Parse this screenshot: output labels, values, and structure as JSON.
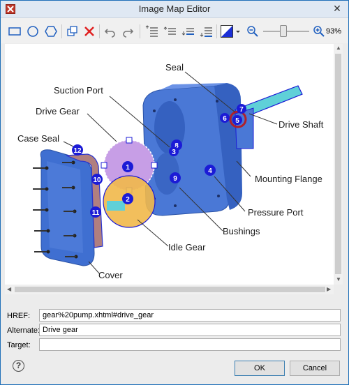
{
  "window": {
    "title": "Image Map Editor"
  },
  "toolbar": {
    "buttons": [
      "rectangle-tool",
      "circle-tool",
      "polygon-tool",
      "duplicate",
      "delete",
      "undo",
      "redo",
      "bring-to-front",
      "bring-forward",
      "send-backward",
      "send-to-back",
      "fill-color",
      "zoom-out",
      "zoom-in"
    ],
    "zoom_level": "93%",
    "zoom_fraction": 0.45
  },
  "image": {
    "callouts": [
      "Seal",
      "Suction Port",
      "Drive Gear",
      "Case Seal",
      "Drive Shaft",
      "Mounting Flange",
      "Pressure Port",
      "Bushings",
      "Idle Gear",
      "Cover"
    ],
    "markers": [
      "1",
      "2",
      "4",
      "5",
      "6",
      "7",
      "8",
      "9",
      "10",
      "11",
      "12",
      "3"
    ]
  },
  "form": {
    "href_label": "HREF:",
    "href_value": "gear%20pump.xhtml#drive_gear",
    "alternate_label": "Alternate:",
    "alternate_value": "Drive gear",
    "target_label": "Target:",
    "target_value": ""
  },
  "buttons": {
    "ok": "OK",
    "cancel": "Cancel"
  },
  "colors": {
    "accent": "#1f6fb8",
    "marker": "#1b1bd6",
    "pump_body": "#4a78d6"
  }
}
